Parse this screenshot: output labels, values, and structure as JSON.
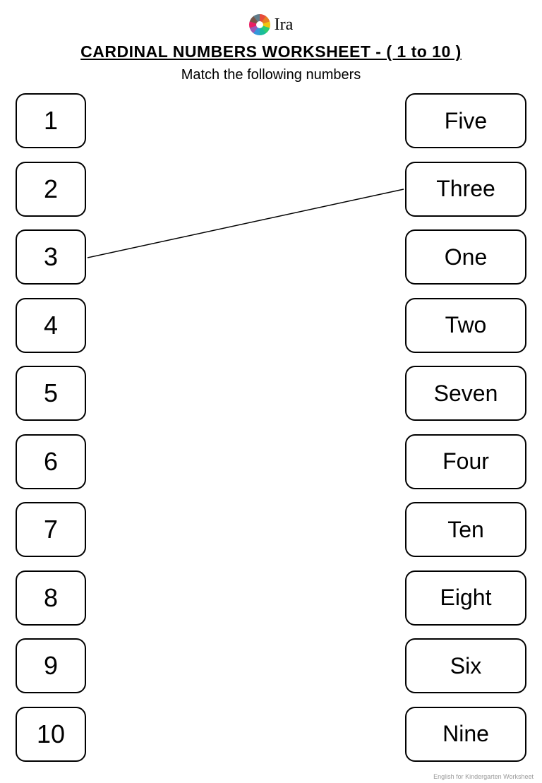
{
  "header": {
    "logo_text": "Ira",
    "title": "CARDINAL NUMBERS WORKSHEET - ( 1 to 10 )",
    "subtitle": "Match the following numbers"
  },
  "left_column": [
    "1",
    "2",
    "3",
    "4",
    "5",
    "6",
    "7",
    "8",
    "9",
    "10"
  ],
  "right_column": [
    "Five",
    "Three",
    "One",
    "Two",
    "Seven",
    "Four",
    "Ten",
    "Eight",
    "Six",
    "Nine"
  ],
  "match": {
    "from_left_index": 2,
    "to_right_index": 1
  },
  "footer": "English for Kindergarten Worksheet"
}
